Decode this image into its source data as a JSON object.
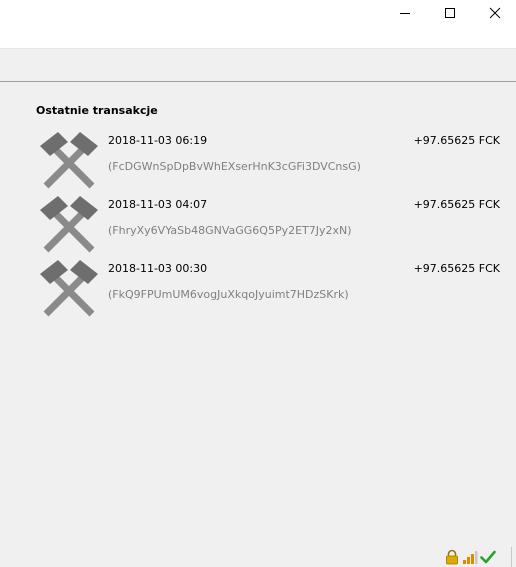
{
  "window": {
    "controls": [
      "minimize",
      "maximize",
      "close"
    ]
  },
  "transactions": {
    "title": "Ostatnie transakcje",
    "items": [
      {
        "date": "2018-11-03 06:19",
        "amount": "+97.65625 FCK",
        "address": "(FcDGWnSpDpBvWhEXserHnK3cGFi3DVCnsG)",
        "icon": "mined-icon"
      },
      {
        "date": "2018-11-03 04:07",
        "amount": "+97.65625 FCK",
        "address": "(FhryXy6VYaSb48GNVaGG6Q5Py2ET7Jy2xN)",
        "icon": "mined-icon"
      },
      {
        "date": "2018-11-03 00:30",
        "amount": "+97.65625 FCK",
        "address": "(FkQ9FPUmUM6vogJuXkqoJyuimt7HDzSKrk)",
        "icon": "mined-icon"
      }
    ]
  },
  "statusbar": {
    "icons": [
      "lock-icon",
      "signal-bars-icon",
      "checkmark-icon"
    ],
    "colors": {
      "lock": "#e0a800",
      "bars": "#e08a00",
      "check": "#2ea02e"
    }
  }
}
